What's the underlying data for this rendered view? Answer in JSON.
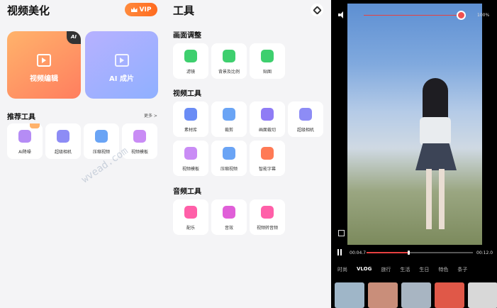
{
  "left": {
    "title": "视频美化",
    "vip_label": "VIP",
    "cards": [
      {
        "label": "视频编辑",
        "badge": "AI"
      },
      {
        "label": "AI 成片"
      }
    ],
    "recommend_title": "推荐工具",
    "more_label": "更多 >",
    "tools": [
      {
        "label": "AI降噪",
        "color": "#b58cf5"
      },
      {
        "label": "超级相机",
        "color": "#8d8cf5"
      },
      {
        "label": "压缩视频",
        "color": "#6aa4f5"
      },
      {
        "label": "视频模板",
        "color": "#c98cf5"
      }
    ]
  },
  "middle": {
    "title": "工具",
    "sections": [
      {
        "title": "画面调整",
        "items": [
          {
            "label": "滤镜",
            "color": "#3ecf6e"
          },
          {
            "label": "背景及比例",
            "color": "#3ecf6e"
          },
          {
            "label": "贴图",
            "color": "#3ecf6e"
          }
        ]
      },
      {
        "title": "视频工具",
        "items": [
          {
            "label": "素材库",
            "color": "#6a8cf5"
          },
          {
            "label": "裁剪",
            "color": "#6aa4f5"
          },
          {
            "label": "画面裁切",
            "color": "#8f7cf5"
          },
          {
            "label": "超级相机",
            "color": "#8d8cf5"
          },
          {
            "label": "视频模板",
            "color": "#c98cf5"
          },
          {
            "label": "压缩视频",
            "color": "#6aa4f5"
          },
          {
            "label": "智能字幕",
            "color": "#ff7a55"
          }
        ]
      },
      {
        "title": "音频工具",
        "items": [
          {
            "label": "配乐",
            "color": "#ff5fa8"
          },
          {
            "label": "音效",
            "color": "#e05fd8"
          },
          {
            "label": "视频转音频",
            "color": "#ff5fa8"
          }
        ]
      }
    ]
  },
  "right": {
    "volume_pct": "100%",
    "time_current": "00:04.7",
    "time_total": "00:12.0",
    "progress": 0.39,
    "tabs": [
      "时尚",
      "VLOG",
      "旅行",
      "生活",
      "生日",
      "特色",
      "条子"
    ],
    "active_tab": 1,
    "thumbs": [
      "#9fb6c8",
      "#c98e7a",
      "#a8b5c2",
      "#e05848",
      "#d8d8d8"
    ]
  },
  "watermark": "wvead.com"
}
